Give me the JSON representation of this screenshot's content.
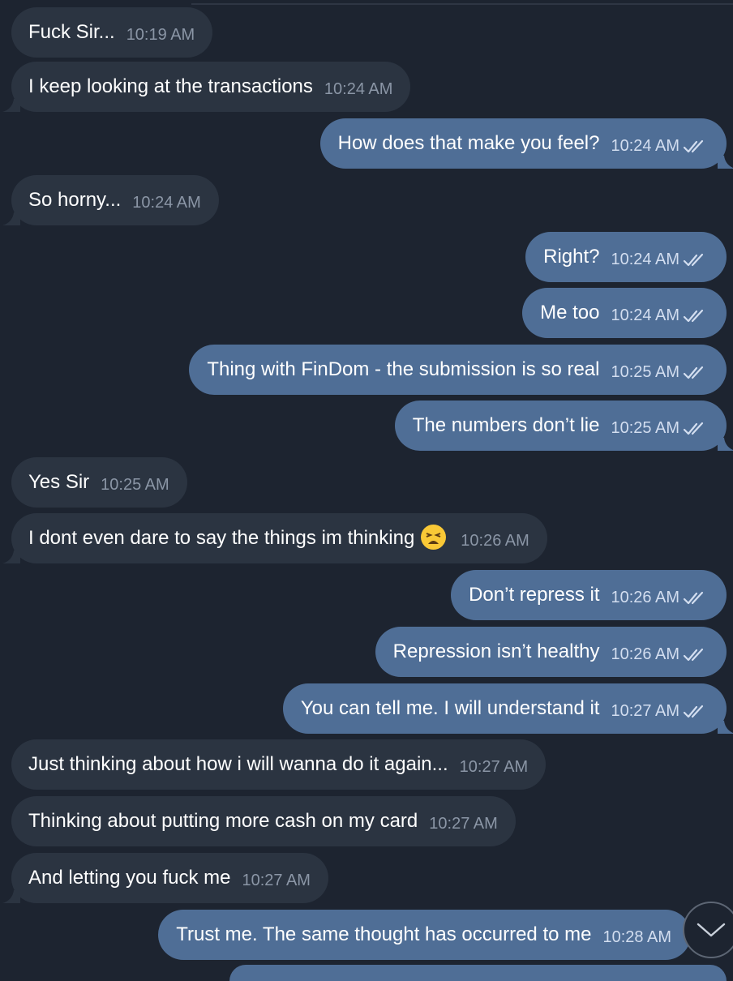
{
  "messages": [
    {
      "dir": "in",
      "text": "Fuck Sir...",
      "time": "10:19 AM",
      "tail": false
    },
    {
      "dir": "in",
      "text": "I keep looking at the transactions",
      "time": "10:24 AM",
      "tail": true
    },
    {
      "dir": "out",
      "text": "How does that make you feel?",
      "time": "10:24 AM",
      "tail": true,
      "read": true
    },
    {
      "dir": "in",
      "text": "So horny...",
      "time": "10:24 AM",
      "tail": true
    },
    {
      "dir": "out",
      "text": "Right?",
      "time": "10:24 AM",
      "tail": false,
      "read": true
    },
    {
      "dir": "out",
      "text": "Me too",
      "time": "10:24 AM",
      "tail": false,
      "read": true
    },
    {
      "dir": "out",
      "text": "Thing with FinDom - the submission is so real",
      "time": "10:25 AM",
      "tail": false,
      "read": true
    },
    {
      "dir": "out",
      "text": "The numbers don’t lie",
      "time": "10:25 AM",
      "tail": true,
      "read": true
    },
    {
      "dir": "in",
      "text": "Yes Sir",
      "time": "10:25 AM",
      "tail": false
    },
    {
      "dir": "in",
      "text": "I dont even dare to say the things im thinking",
      "time": "10:26 AM",
      "tail": true,
      "emoji": "tired-face-emoji"
    },
    {
      "dir": "out",
      "text": "Don’t repress it",
      "time": "10:26 AM",
      "tail": false,
      "read": true
    },
    {
      "dir": "out",
      "text": "Repression isn’t healthy",
      "time": "10:26 AM",
      "tail": false,
      "read": true
    },
    {
      "dir": "out",
      "text": "You can tell me. I will understand it",
      "time": "10:27 AM",
      "tail": true,
      "read": true
    },
    {
      "dir": "in",
      "text": "Just thinking about how i will wanna do it again...",
      "time": "10:27 AM",
      "tail": false
    },
    {
      "dir": "in",
      "text": "Thinking about putting more cash on my card",
      "time": "10:27 AM",
      "tail": false
    },
    {
      "dir": "in",
      "text": "And letting you fuck me",
      "time": "10:27 AM",
      "tail": true
    },
    {
      "dir": "out",
      "text": "Trust me.  The same thought has occurred to me",
      "time": "10:28 AM",
      "tail": false,
      "read": false
    }
  ],
  "scroll_button": {
    "icon": "chevron-down-icon"
  },
  "colors": {
    "background": "#1d2430",
    "incoming_bubble": "#2b3441",
    "outgoing_bubble": "#4f6e96"
  }
}
